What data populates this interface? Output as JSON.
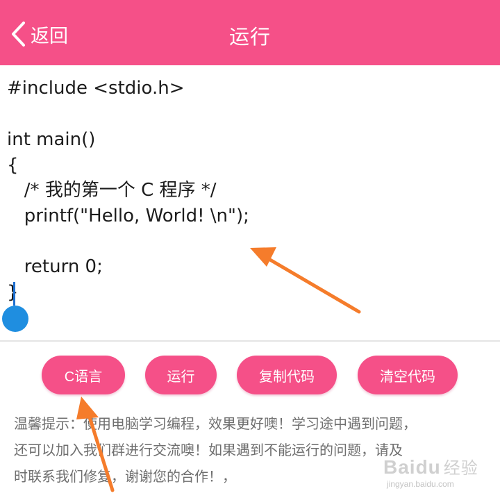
{
  "header": {
    "back_label": "返回",
    "title": "运行"
  },
  "editor": {
    "lines": [
      "#include <stdio.h>",
      "",
      "int main()",
      "{",
      "   /* 我的第一个 C 程序 */",
      "   printf(\"Hello, World! \\n\");",
      "",
      "   return 0;",
      "}"
    ]
  },
  "buttons": {
    "language": "C语言",
    "run": "运行",
    "copy": "复制代码",
    "clear": "清空代码"
  },
  "tip": {
    "lines": [
      "温馨提示：使用电脑学习编程，效果更好噢！学习途中遇到问题，",
      "还可以加入我们群进行交流噢！如果遇到不能运行的问题，请及",
      "时联系我们修复，谢谢您的合作！，"
    ]
  },
  "watermark": {
    "logo": "Baidu",
    "logo_cn": "经验",
    "url": "jingyan.baidu.com"
  },
  "colors": {
    "accent": "#f55088",
    "caret": "#1f8ee0",
    "arrow": "#f57c2b"
  }
}
